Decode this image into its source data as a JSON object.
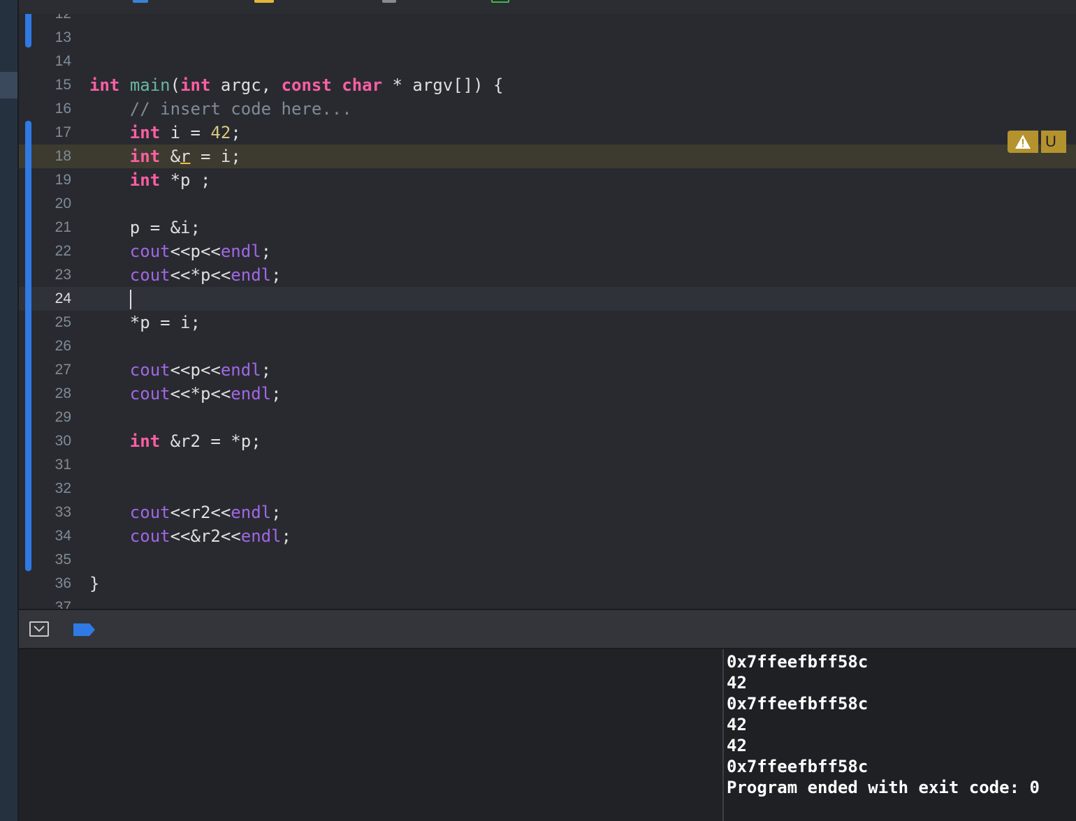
{
  "editor": {
    "partial_top_line": "12",
    "partial_bottom_line": "37",
    "current_line": 24,
    "warning_line": 18,
    "warning_next_label": "U",
    "lines": [
      {
        "n": "13",
        "tokens": []
      },
      {
        "n": "14",
        "tokens": []
      },
      {
        "n": "15",
        "tokens": [
          {
            "t": "int",
            "c": "kw"
          },
          {
            "t": " "
          },
          {
            "t": "main",
            "c": "fn"
          },
          {
            "t": "("
          },
          {
            "t": "int",
            "c": "kw"
          },
          {
            "t": " argc, "
          },
          {
            "t": "const",
            "c": "kw"
          },
          {
            "t": " "
          },
          {
            "t": "char",
            "c": "kw"
          },
          {
            "t": " * argv[]) {"
          }
        ]
      },
      {
        "n": "16",
        "tokens": [
          {
            "t": "    "
          },
          {
            "t": "// insert code here...",
            "c": "cmt"
          }
        ]
      },
      {
        "n": "17",
        "tokens": [
          {
            "t": "    "
          },
          {
            "t": "int",
            "c": "kw"
          },
          {
            "t": " i = "
          },
          {
            "t": "42",
            "c": "num"
          },
          {
            "t": ";"
          }
        ]
      },
      {
        "n": "18",
        "tokens": [
          {
            "t": "    "
          },
          {
            "t": "int",
            "c": "kw"
          },
          {
            "t": " &"
          },
          {
            "t": "r",
            "c": "wu"
          },
          {
            "t": " = i;"
          }
        ]
      },
      {
        "n": "19",
        "tokens": [
          {
            "t": "    "
          },
          {
            "t": "int",
            "c": "kw"
          },
          {
            "t": " *p ;"
          }
        ]
      },
      {
        "n": "20",
        "tokens": []
      },
      {
        "n": "21",
        "tokens": [
          {
            "t": "    p = &i;"
          }
        ]
      },
      {
        "n": "22",
        "tokens": [
          {
            "t": "    "
          },
          {
            "t": "cout",
            "c": "lib"
          },
          {
            "t": "<<p<<"
          },
          {
            "t": "endl",
            "c": "lib"
          },
          {
            "t": ";"
          }
        ]
      },
      {
        "n": "23",
        "tokens": [
          {
            "t": "    "
          },
          {
            "t": "cout",
            "c": "lib"
          },
          {
            "t": "<<*p<<"
          },
          {
            "t": "endl",
            "c": "lib"
          },
          {
            "t": ";"
          }
        ]
      },
      {
        "n": "24",
        "tokens": [
          {
            "t": "    "
          },
          {
            "t": "",
            "c": "caret"
          }
        ]
      },
      {
        "n": "25",
        "tokens": [
          {
            "t": "    *p = i;"
          }
        ]
      },
      {
        "n": "26",
        "tokens": []
      },
      {
        "n": "27",
        "tokens": [
          {
            "t": "    "
          },
          {
            "t": "cout",
            "c": "lib"
          },
          {
            "t": "<<p<<"
          },
          {
            "t": "endl",
            "c": "lib"
          },
          {
            "t": ";"
          }
        ]
      },
      {
        "n": "28",
        "tokens": [
          {
            "t": "    "
          },
          {
            "t": "cout",
            "c": "lib"
          },
          {
            "t": "<<*p<<"
          },
          {
            "t": "endl",
            "c": "lib"
          },
          {
            "t": ";"
          }
        ]
      },
      {
        "n": "29",
        "tokens": []
      },
      {
        "n": "30",
        "tokens": [
          {
            "t": "    "
          },
          {
            "t": "int",
            "c": "kw"
          },
          {
            "t": " &r2 = *p;"
          }
        ]
      },
      {
        "n": "31",
        "tokens": []
      },
      {
        "n": "32",
        "tokens": []
      },
      {
        "n": "33",
        "tokens": [
          {
            "t": "    "
          },
          {
            "t": "cout",
            "c": "lib"
          },
          {
            "t": "<<r2<<"
          },
          {
            "t": "endl",
            "c": "lib"
          },
          {
            "t": ";"
          }
        ]
      },
      {
        "n": "34",
        "tokens": [
          {
            "t": "    "
          },
          {
            "t": "cout",
            "c": "lib"
          },
          {
            "t": "<<&r2<<"
          },
          {
            "t": "endl",
            "c": "lib"
          },
          {
            "t": ";"
          }
        ]
      },
      {
        "n": "35",
        "tokens": []
      },
      {
        "n": "36",
        "tokens": [
          {
            "t": "}"
          }
        ]
      }
    ]
  },
  "debug_bar": {
    "toggle_icon": "hide-debug-area-icon",
    "breakpoint_icon": "breakpoints-toggle-icon",
    "accent_color": "#2f7ae5"
  },
  "console": {
    "output": [
      "0x7ffeefbff58c",
      "42",
      "0x7ffeefbff58c",
      "42",
      "42",
      "0x7ffeefbff58c",
      "Program ended with exit code: 0"
    ]
  },
  "colors": {
    "keyword": "#fc5fa3",
    "function": "#67b7a4",
    "library": "#a167e6",
    "number": "#d9c97c",
    "comment": "#7f8c98",
    "warning": "#b4922e"
  }
}
